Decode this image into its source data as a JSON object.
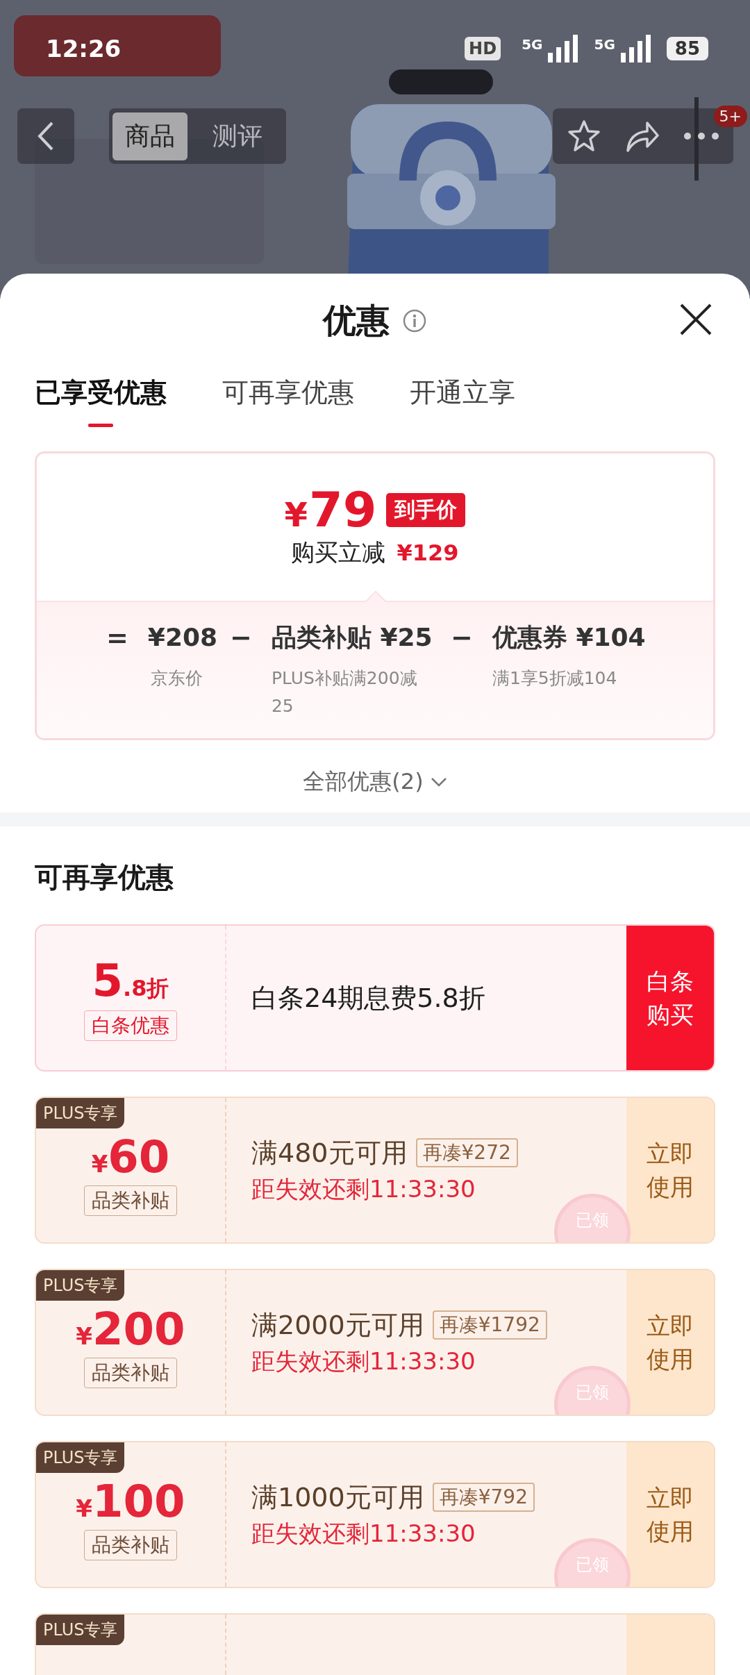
{
  "status_bar": {
    "time": "12:26",
    "hd": "HD",
    "networks": [
      "5G",
      "5G"
    ],
    "battery": "85"
  },
  "nav": {
    "tabs": [
      {
        "label": "商品",
        "selected": true
      },
      {
        "label": "测评",
        "selected": false
      }
    ],
    "badge": "5+"
  },
  "sheet": {
    "title": "优惠",
    "tabs": [
      {
        "label": "已享受优惠",
        "selected": true
      },
      {
        "label": "可再享优惠",
        "selected": false
      },
      {
        "label": "开通立享",
        "selected": false
      }
    ],
    "summary": {
      "currency": "¥",
      "amount": "79",
      "price_tag": "到手价",
      "savings_label": "购买立减",
      "savings_amount": "¥129",
      "formula": [
        {
          "op": "=",
          "value": "¥208",
          "note": "京东价"
        },
        {
          "op": "−",
          "value": "品类补贴 ¥25",
          "note": "PLUS补贴满200减25"
        },
        {
          "op": "−",
          "value": "优惠券 ¥104",
          "note": "满1享5折减104"
        }
      ]
    },
    "expand_link": "全部优惠(2)"
  },
  "more_offers": {
    "title": "可再享优惠",
    "coupons": [
      {
        "kind": "baitiao",
        "value_main": "5",
        "value_suffix": ".8折",
        "tag": "白条优惠",
        "text": "白条24期息费5.8折",
        "button": "白条购买"
      },
      {
        "kind": "plus",
        "badge": "PLUS专享",
        "currency": "¥",
        "amount": "60",
        "tag": "品类补贴",
        "condition": "满480元可用",
        "chip": "再凑¥272",
        "countdown": "距失效还剩11:33:30",
        "button": "立即使用",
        "stamp": "已领"
      },
      {
        "kind": "plus",
        "badge": "PLUS专享",
        "currency": "¥",
        "amount": "200",
        "tag": "品类补贴",
        "condition": "满2000元可用",
        "chip": "再凑¥1792",
        "countdown": "距失效还剩11:33:30",
        "button": "立即使用",
        "stamp": "已领"
      },
      {
        "kind": "plus",
        "badge": "PLUS专享",
        "currency": "¥",
        "amount": "100",
        "tag": "品类补贴",
        "condition": "满1000元可用",
        "chip": "再凑¥792",
        "countdown": "距失效还剩11:33:30",
        "button": "立即使用",
        "stamp": "已领"
      },
      {
        "kind": "plus",
        "badge": "PLUS专享"
      }
    ]
  }
}
